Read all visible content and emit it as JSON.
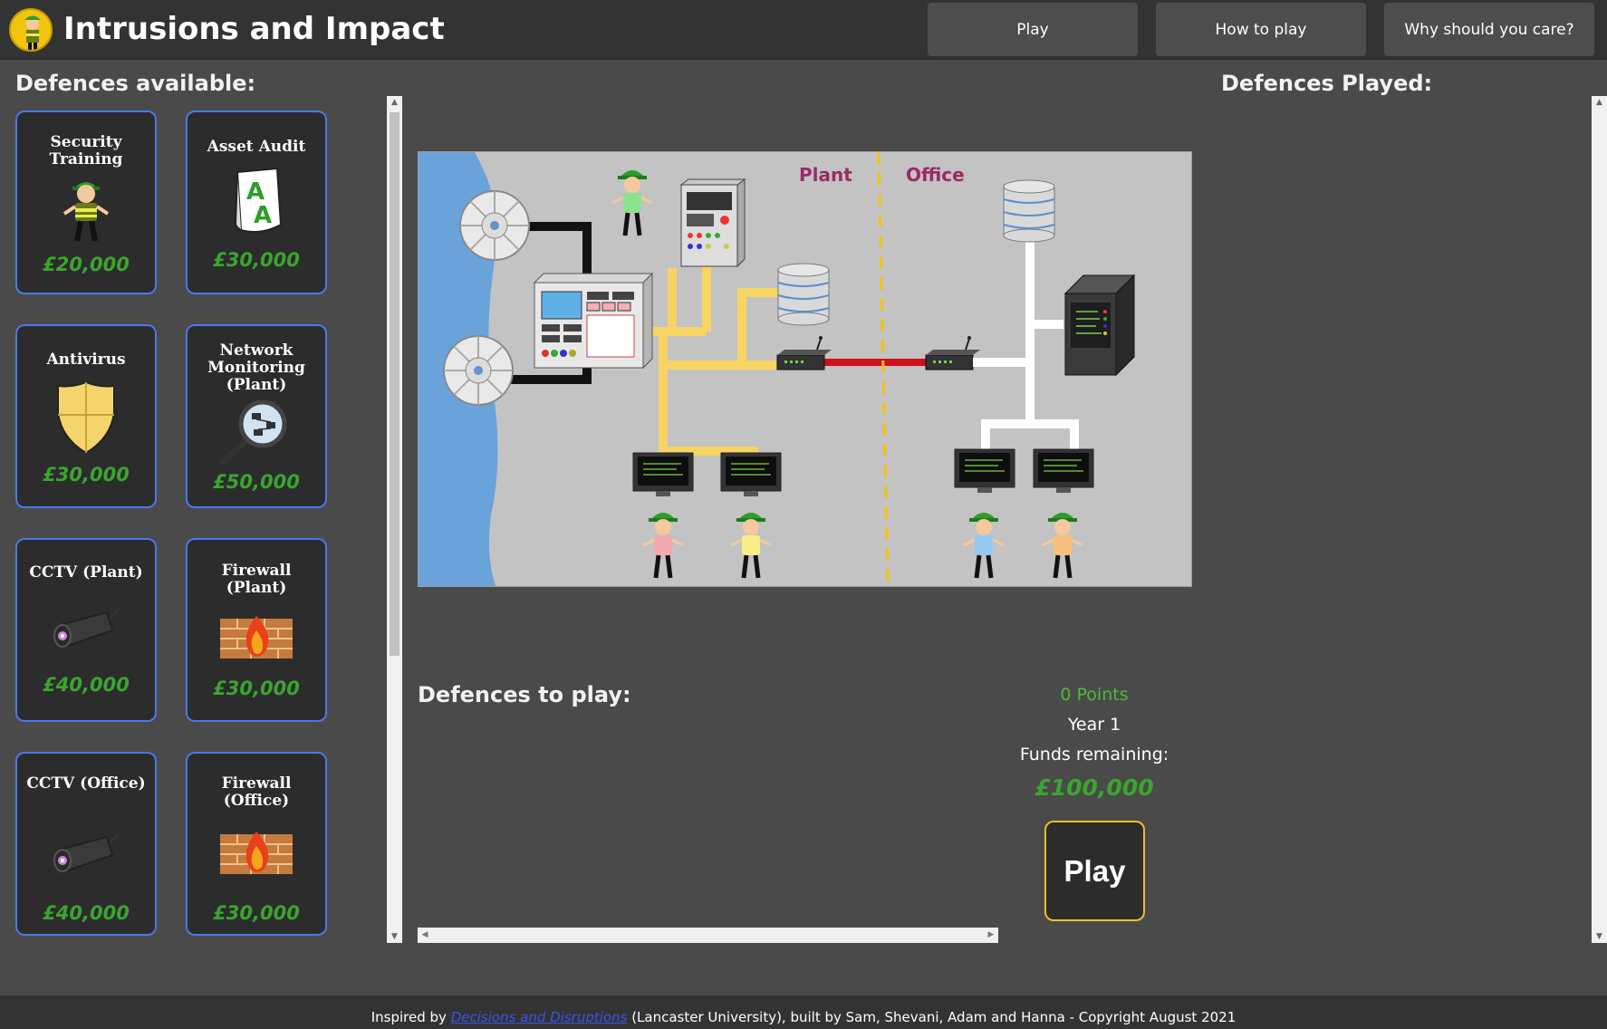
{
  "header": {
    "title": "Intrusions and Impact",
    "nav": [
      "Play",
      "How to play",
      "Why should you care?"
    ]
  },
  "left": {
    "title": "Defences available:",
    "cards": [
      {
        "name": "Security Training",
        "price": "£20,000",
        "icon": "guard-icon"
      },
      {
        "name": "Asset Audit",
        "price": "£30,000",
        "icon": "document-icon"
      },
      {
        "name": "Antivirus",
        "price": "£30,000",
        "icon": "shield-icon"
      },
      {
        "name": "Network Monitoring (Plant)",
        "price": "£50,000",
        "icon": "magnifier-network-icon"
      },
      {
        "name": "CCTV (Plant)",
        "price": "£40,000",
        "icon": "camera-icon"
      },
      {
        "name": "Firewall (Plant)",
        "price": "£30,000",
        "icon": "firewall-icon"
      },
      {
        "name": "CCTV (Office)",
        "price": "£40,000",
        "icon": "camera-icon"
      },
      {
        "name": "Firewall (Office)",
        "price": "£30,000",
        "icon": "firewall-icon"
      }
    ]
  },
  "diagram": {
    "zones": [
      "Plant",
      "Office"
    ]
  },
  "to_play": {
    "title": "Defences to play:"
  },
  "stats": {
    "points": "0 Points",
    "year": "Year 1",
    "funds_label": "Funds remaining:",
    "funds": "£100,000",
    "play_button": "Play"
  },
  "right": {
    "title": "Defences Played:"
  },
  "footer": {
    "prefix": "Inspired by ",
    "link": "Decisions and Disruptions",
    "suffix": " (Lancaster University), built by Sam, Shevani, Adam and Hanna - Copyright August 2021"
  },
  "colors": {
    "card_border": "#4a78e8",
    "price": "#3aa52f",
    "play_border": "#e6c229",
    "plant_network": "#f7d463",
    "office_network": "#ffffff",
    "link_red": "#d0101a",
    "zone_label": "#9b2a66"
  }
}
